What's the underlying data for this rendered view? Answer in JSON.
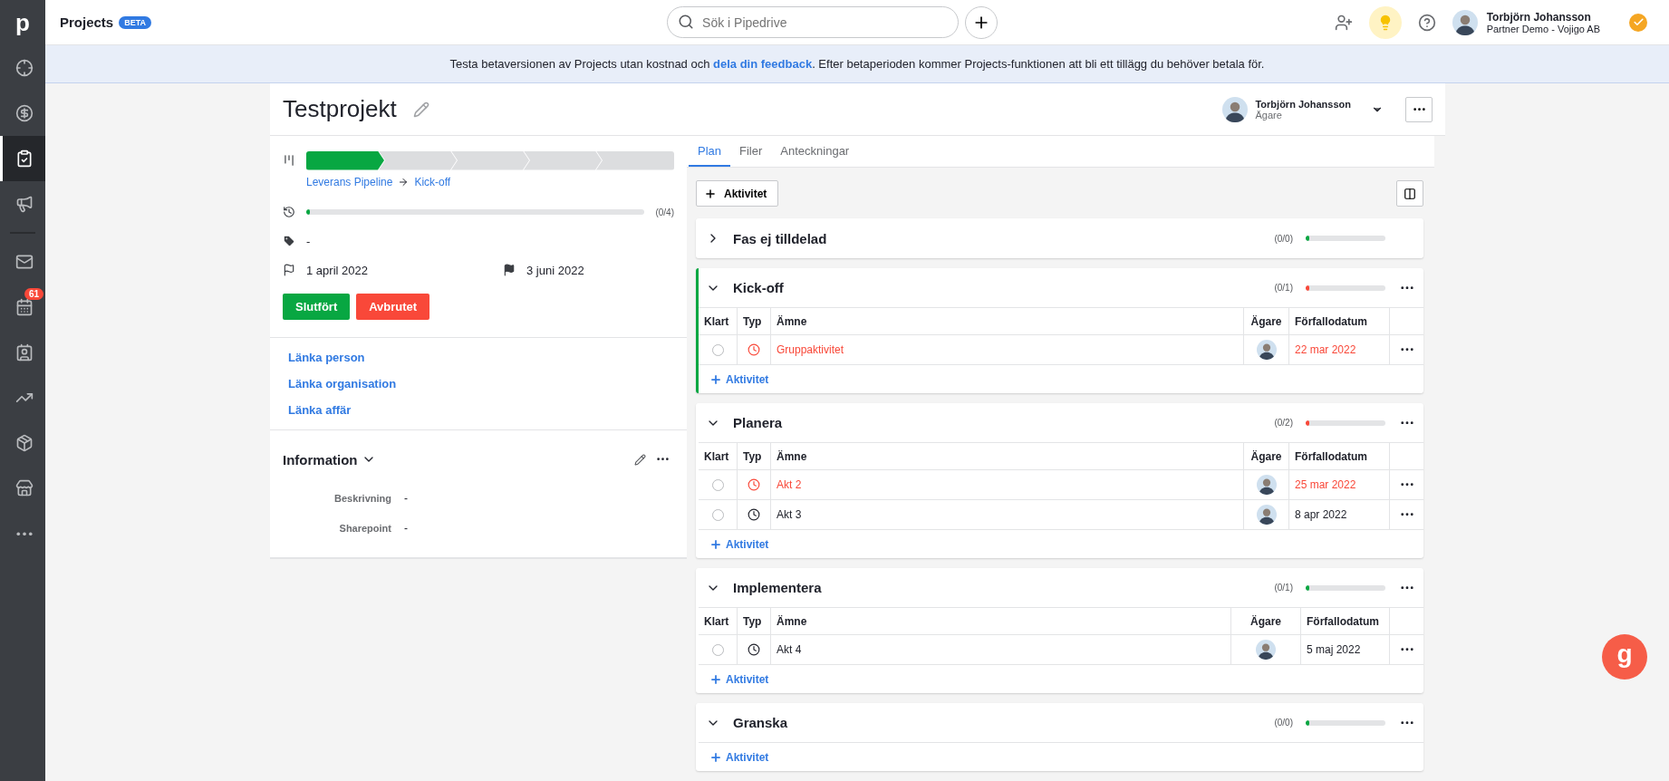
{
  "app": {
    "logo": "p",
    "title": "Projects",
    "badge": "BETA"
  },
  "sidebar": {
    "items": [
      {
        "selected": false
      },
      {
        "selected": false
      },
      {
        "selected": true
      },
      {
        "selected": false
      },
      {
        "selected": false
      },
      {
        "selected": false,
        "badge": "61"
      },
      {
        "selected": false
      },
      {
        "selected": false
      },
      {
        "selected": false
      },
      {
        "selected": false
      },
      {
        "selected": false
      }
    ]
  },
  "search": {
    "placeholder": "Sök i Pipedrive"
  },
  "user": {
    "name": "Torbjörn Johansson",
    "company": "Partner Demo - Vojigo AB"
  },
  "banner": {
    "before": "Testa betaversionen av Projects utan kostnad och ",
    "link": "dela din feedback",
    "after": ". Efter betaperioden kommer Projects-funktionen att bli ett tillägg du behöver betala för."
  },
  "project": {
    "title": "Testprojekt",
    "owner": {
      "name": "Torbjörn Johansson",
      "role": "Ägare"
    }
  },
  "pipeline": {
    "stages": [
      {
        "reached": true
      },
      {
        "reached": false
      },
      {
        "reached": false
      },
      {
        "reached": false
      },
      {
        "reached": false
      }
    ],
    "name": "Leverans Pipeline",
    "stage": "Kick-off"
  },
  "progress": {
    "level": 0.01,
    "count": "(0/4)"
  },
  "labels": "-",
  "start_date": "1 april 2022",
  "end_date": "3 juni 2022",
  "buttons": [
    {
      "label": "Slutfört",
      "kind": "won"
    },
    {
      "label": "Avbrutet",
      "kind": "lost"
    }
  ],
  "links": [
    "Länka person",
    "Länka organisation",
    "Länka affär"
  ],
  "information": {
    "title": "Information",
    "fields": [
      {
        "label": "Beskrivning",
        "value": "-"
      },
      {
        "label": "Sharepoint",
        "value": "-"
      }
    ]
  },
  "tabs": [
    {
      "label": "Plan",
      "selected": true
    },
    {
      "label": "Filer",
      "selected": false
    },
    {
      "label": "Anteckningar",
      "selected": false
    }
  ],
  "add_activity": "Aktivitet",
  "phases": [
    {
      "title": "Fas ej tilldelad",
      "expanded": false,
      "current": false,
      "has_menu": false,
      "count": "(0/0)",
      "level": 0.02,
      "color": "#08a742"
    },
    {
      "title": "Kick-off",
      "expanded": true,
      "current": true,
      "has_menu": true,
      "count": "(0/1)",
      "level": 0.02,
      "color": "#f94839",
      "columns": [
        "Klart",
        "Typ",
        "Ämne",
        "Ägare",
        "Förfallodatum"
      ],
      "activities": [
        {
          "done": false,
          "overdue": true,
          "subject": "Gruppaktivitet",
          "due": "22 mar 2022"
        }
      ],
      "add_label": "Aktivitet"
    },
    {
      "title": "Planera",
      "expanded": true,
      "current": false,
      "has_menu": true,
      "count": "(0/2)",
      "level": 0.02,
      "color": "#f94839",
      "columns": [
        "Klart",
        "Typ",
        "Ämne",
        "Ägare",
        "Förfallodatum"
      ],
      "activities": [
        {
          "done": false,
          "overdue": true,
          "subject": "Akt 2",
          "due": "25 mar 2022"
        },
        {
          "done": false,
          "overdue": false,
          "subject": "Akt 3",
          "due": "8 apr 2022"
        }
      ],
      "add_label": "Aktivitet"
    },
    {
      "title": "Implementera",
      "expanded": true,
      "current": false,
      "has_menu": true,
      "count": "(0/1)",
      "level": 0.02,
      "color": "#08a742",
      "columns": [
        "Klart",
        "Typ",
        "Ämne",
        "Ägare",
        "Förfallodatum"
      ],
      "activities": [
        {
          "done": false,
          "overdue": false,
          "subject": "Akt 4",
          "due": "5 maj 2022"
        }
      ],
      "add_label": "Aktivitet"
    },
    {
      "title": "Granska",
      "expanded": true,
      "current": false,
      "has_menu": true,
      "count": "(0/0)",
      "level": 0.02,
      "color": "#08a742",
      "add_label": "Aktivitet"
    }
  ],
  "chat_widget": {
    "label": "g"
  }
}
